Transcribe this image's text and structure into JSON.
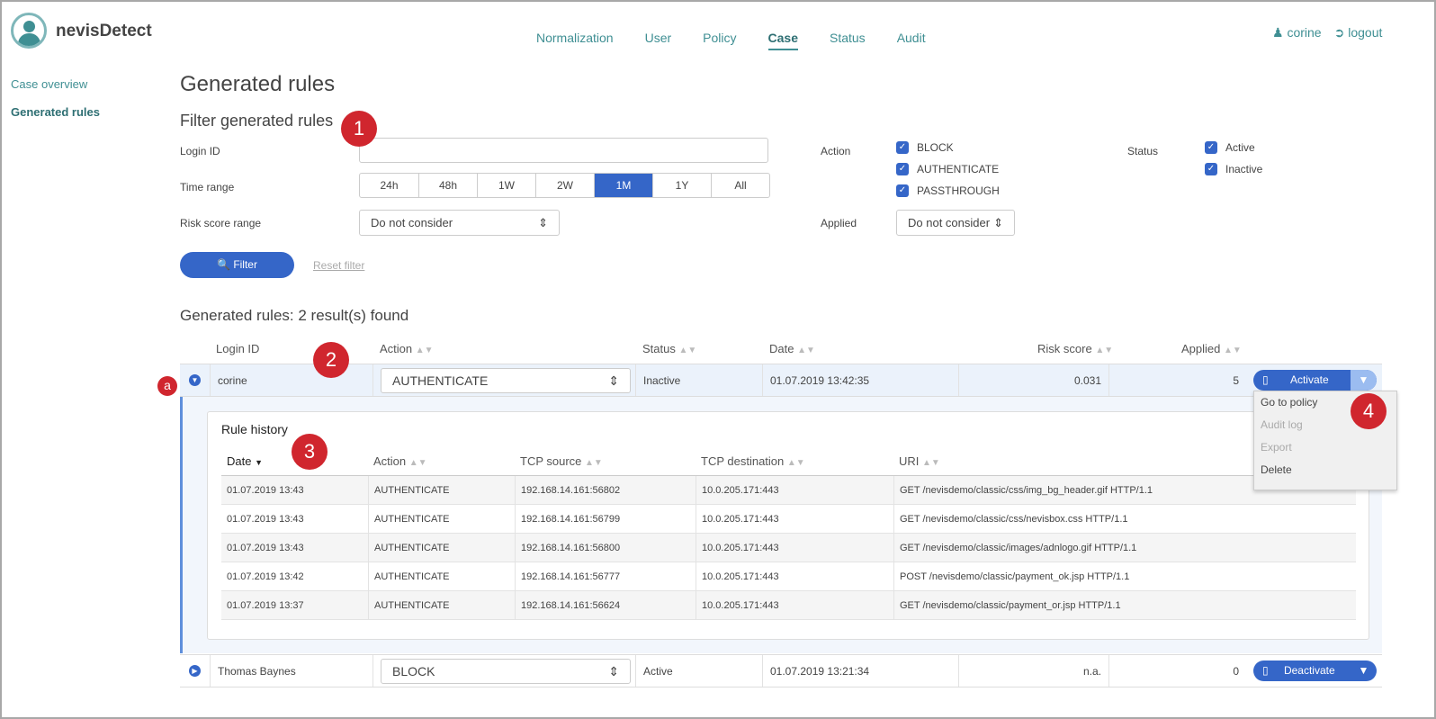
{
  "app": {
    "name": "nevisDetect"
  },
  "nav": {
    "items": [
      "Normalization",
      "User",
      "Policy",
      "Case",
      "Status",
      "Audit"
    ],
    "active": "Case"
  },
  "user": {
    "name": "corine",
    "logout": "logout"
  },
  "sidebar": {
    "items": [
      "Case overview",
      "Generated rules"
    ],
    "active": "Generated rules"
  },
  "page": {
    "title": "Generated rules"
  },
  "filter": {
    "title": "Filter generated rules",
    "login_label": "Login ID",
    "login_value": "",
    "time_label": "Time range",
    "time_options": [
      "24h",
      "48h",
      "1W",
      "2W",
      "1M",
      "1Y",
      "All"
    ],
    "time_selected": "1M",
    "risk_label": "Risk score range",
    "risk_value": "Do not consider",
    "action_label": "Action",
    "actions": [
      "BLOCK",
      "AUTHENTICATE",
      "PASSTHROUGH"
    ],
    "status_label": "Status",
    "statuses": [
      "Active",
      "Inactive"
    ],
    "applied_label": "Applied",
    "applied_value": "Do not consider",
    "filter_button": "Filter",
    "reset": "Reset filter"
  },
  "results": {
    "summary": "Generated rules: 2 result(s) found",
    "headers": [
      "Login ID",
      "Action",
      "Status",
      "Date",
      "Risk score",
      "Applied"
    ],
    "rows": [
      {
        "login": "corine",
        "action": "AUTHENTICATE",
        "status": "Inactive",
        "date": "01.07.2019 13:42:35",
        "risk": "0.031",
        "applied": "5",
        "button": "Activate"
      },
      {
        "login": "Thomas Baynes",
        "action": "BLOCK",
        "status": "Active",
        "date": "01.07.2019 13:21:34",
        "risk": "n.a.",
        "applied": "0",
        "button": "Deactivate"
      }
    ]
  },
  "history": {
    "title": "Rule history",
    "headers": [
      "Date",
      "Action",
      "TCP source",
      "TCP destination",
      "URI"
    ],
    "rows": [
      [
        "01.07.2019 13:43",
        "AUTHENTICATE",
        "192.168.14.161:56802",
        "10.0.205.171:443",
        "GET /nevisdemo/classic/css/img_bg_header.gif HTTP/1.1"
      ],
      [
        "01.07.2019 13:43",
        "AUTHENTICATE",
        "192.168.14.161:56799",
        "10.0.205.171:443",
        "GET /nevisdemo/classic/css/nevisbox.css HTTP/1.1"
      ],
      [
        "01.07.2019 13:43",
        "AUTHENTICATE",
        "192.168.14.161:56800",
        "10.0.205.171:443",
        "GET /nevisdemo/classic/images/adnlogo.gif HTTP/1.1"
      ],
      [
        "01.07.2019 13:42",
        "AUTHENTICATE",
        "192.168.14.161:56777",
        "10.0.205.171:443",
        "POST /nevisdemo/classic/payment_ok.jsp HTTP/1.1"
      ],
      [
        "01.07.2019 13:37",
        "AUTHENTICATE",
        "192.168.14.161:56624",
        "10.0.205.171:443",
        "GET /nevisdemo/classic/payment_or.jsp HTTP/1.1"
      ]
    ]
  },
  "menu": {
    "items": [
      "Go to policy",
      "Audit log",
      "Export",
      "Delete"
    ]
  },
  "callouts": [
    "1",
    "2",
    "3",
    "4",
    "a"
  ],
  "colors": {
    "accent": "#3f8f93",
    "primary": "#3566c8",
    "callout": "#d0262e"
  }
}
